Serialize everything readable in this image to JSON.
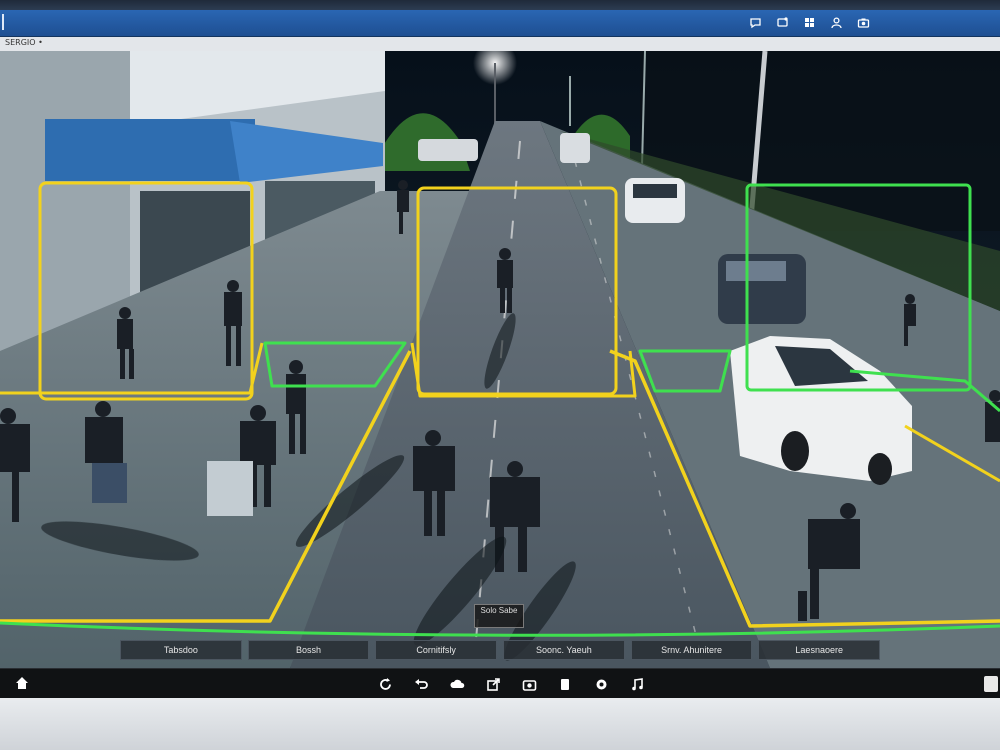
{
  "window": {
    "breadcrumb": "SERGIO •"
  },
  "toolbar_icons": [
    "chat-icon",
    "message-icon",
    "grid-icon",
    "user-icon",
    "camera-icon"
  ],
  "camera": {
    "overlay_tag": "Solo Sabe"
  },
  "zones": [
    {
      "label": "Tabsdoo"
    },
    {
      "label": "Bossh"
    },
    {
      "label": "Cornitifsly"
    },
    {
      "label": "Soonc. Yaeuh"
    },
    {
      "label": "Srnv. Ahunitere"
    },
    {
      "label": "Laesnaoere"
    }
  ],
  "controls": [
    "refresh-icon",
    "undo-icon",
    "cloud-icon",
    "export-icon",
    "capture-icon",
    "copy-icon",
    "settings-icon",
    "music-icon"
  ],
  "colors": {
    "zone_yellow": "#f2d21d",
    "zone_green": "#3fe04f",
    "titlebar": "#2462ac"
  }
}
